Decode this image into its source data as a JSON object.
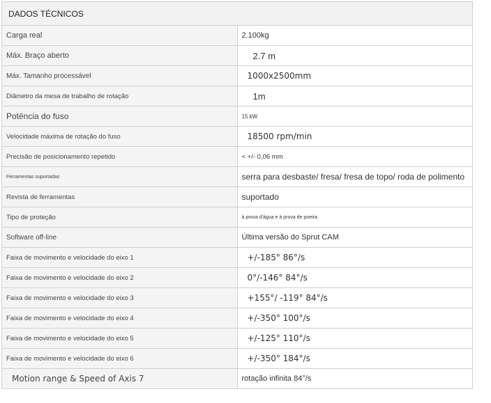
{
  "title": "DADOS TÉCNICOS",
  "rows": [
    {
      "label": "Carga real",
      "value": "2.100kg"
    },
    {
      "label": "Máx. Braço aberto",
      "value": "2.7 m"
    },
    {
      "label": "Máx. Tamanho processável",
      "value": "1000x2500mm"
    },
    {
      "label": "Diâmetro da mesa de trabalho de rotação",
      "value": "1m"
    },
    {
      "label": "Potência do fuso",
      "value": "15 kW"
    },
    {
      "label": "Velocidade máxima de rotação do fuso",
      "value": "18500 rpm/min"
    },
    {
      "label": "Precisão de posicionamento repetido",
      "value": "< +/- 0,06 mm"
    },
    {
      "label": "Ferramentas suportadas",
      "value": "serra para desbaste/ fresa/ fresa de topo/ roda de polimento"
    },
    {
      "label": "Revista de ferramentas",
      "value": "suportado"
    },
    {
      "label": "Tipo de proteção",
      "value": "à prova d'água e à prova de poeira"
    },
    {
      "label": "Software off-line",
      "value": "Última versão do Sprut CAM"
    },
    {
      "label": "Faixa de movimento e velocidade do eixo 1",
      "value": "+/-185°   86°/s"
    },
    {
      "label": "Faixa de movimento e velocidade do eixo 2",
      "value": "0°/-146°   84°/s"
    },
    {
      "label": "Faixa de movimento e velocidade do eixo 3",
      "value": "+155°/ -119°    84°/s"
    },
    {
      "label": "Faixa de movimento e velocidade do eixo 4",
      "value": "+/-350°    100°/s"
    },
    {
      "label": "Faixa de movimento e velocidade do eixo 5",
      "value": "+/-125°    110°/s"
    },
    {
      "label": "Faixa de movimento e velocidade do eixo 6",
      "value": "+/-350°    184°/s"
    },
    {
      "label": "Motion range & Speed of Axis 7",
      "value": "rotação infinita 84°/s"
    }
  ]
}
